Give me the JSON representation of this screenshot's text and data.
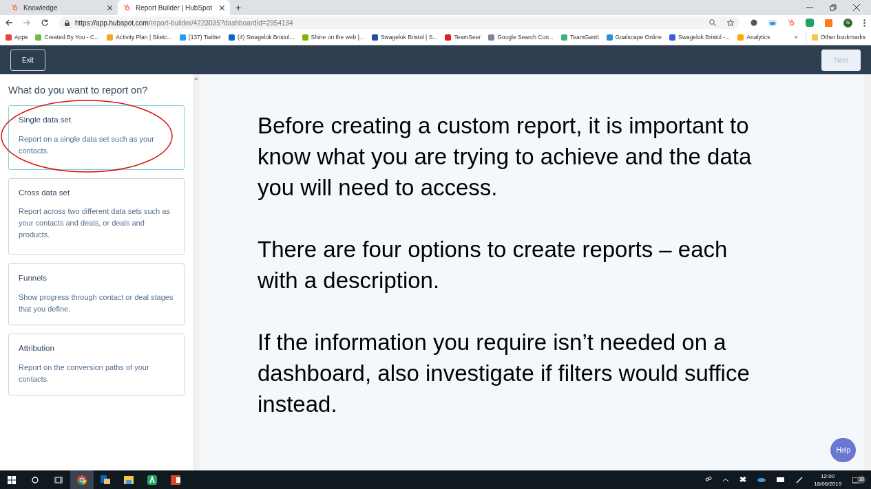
{
  "browser": {
    "tabs": [
      {
        "title": "Knowledge",
        "selected": false
      },
      {
        "title": "Report Builder | HubSpot",
        "selected": true
      }
    ],
    "new_tab": "+",
    "url": {
      "host": "https://app.hubspot.com",
      "path": "/report-builder/4223035?dashboardId=2954134"
    },
    "bookmarks": [
      {
        "label": "Apps",
        "color": "#e94235"
      },
      {
        "label": "Created By You - C...",
        "color": "#6cbf3c"
      },
      {
        "label": "Activity Plan | Sketc...",
        "color": "#f5a623"
      },
      {
        "label": "(137) Twitter",
        "color": "#1da1f2"
      },
      {
        "label": "(4) Swagelok Bristol...",
        "color": "#0a66c2"
      },
      {
        "label": "Shine on the web |...",
        "color": "#7ab800"
      },
      {
        "label": "Swagelok Bristol | S...",
        "color": "#1f4e9c"
      },
      {
        "label": "TeamSeer",
        "color": "#e02020"
      },
      {
        "label": "Google Search Con...",
        "color": "#7a8a99"
      },
      {
        "label": "TeamGantt",
        "color": "#3fb37f"
      },
      {
        "label": "Goalscape Online",
        "color": "#2b8fd6"
      },
      {
        "label": "Swagelok Bristol -...",
        "color": "#3b5bdb"
      },
      {
        "label": "Analytics",
        "color": "#f9ab00"
      }
    ],
    "bookmarks_overflow": "»",
    "other_bookmarks": "Other bookmarks",
    "profile": "S"
  },
  "app": {
    "exit": "Exit",
    "next": {
      "label": "Next",
      "disabled": true
    },
    "heading": "What do you want to report on?",
    "options": [
      {
        "title": "Single data set",
        "description": "Report on a single data set such as your contacts.",
        "selected": true,
        "circled": true
      },
      {
        "title": "Cross data set",
        "description": "Report across two different data sets such as your contacts and deals, or deals and products.",
        "selected": false,
        "circled": false
      },
      {
        "title": "Funnels",
        "description": "Show progress through contact or deal stages that you define.",
        "selected": false,
        "circled": false
      },
      {
        "title": "Attribution",
        "description": "Report on the conversion paths of your contacts.",
        "selected": false,
        "circled": false
      }
    ],
    "paragraphs": [
      "Before creating a custom report, it is important to know what you are trying to achieve and the data you will need to access.",
      "There are four options to create reports – each with a description.",
      "If the information you require isn’t needed on a dashboard, also investigate if filters would suffice instead."
    ],
    "help": "Help"
  },
  "taskbar": {
    "time": "12:00",
    "date": "18/06/2019",
    "notifications": "18"
  }
}
